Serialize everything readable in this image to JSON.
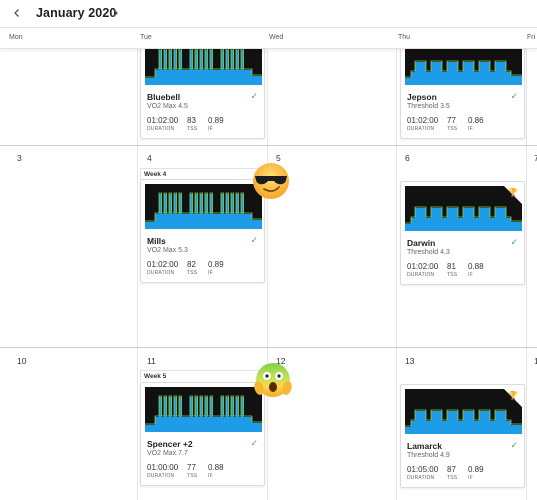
{
  "header": {
    "month": "January 2020",
    "prev_icon": "chevron-left-icon",
    "next_icon": "chevron-right-icon"
  },
  "days": [
    "Mon",
    "Tue",
    "Wed",
    "Thu",
    "Fri"
  ],
  "weeks": [
    {
      "dates": [
        "",
        "",
        "",
        "",
        ""
      ]
    },
    {
      "dates": [
        "3",
        "4",
        "5",
        "6",
        "7"
      ],
      "label": "Week 4"
    },
    {
      "dates": [
        "10",
        "11",
        "12",
        "13",
        "1"
      ],
      "label": "Week 5"
    }
  ],
  "workouts": [
    {
      "name": "Bluebell",
      "subtitle": "VO2 Max 4.5",
      "duration": "01:02:00",
      "tss": "83",
      "if": "0.89",
      "labels": {
        "duration": "DURATION",
        "tss": "TSS",
        "if": "IF"
      },
      "completed": true,
      "chart": "vo2"
    },
    {
      "name": "Jepson",
      "subtitle": "Threshold 3.5",
      "duration": "01:02:00",
      "tss": "77",
      "if": "0.86",
      "labels": {
        "duration": "DURATION",
        "tss": "TSS",
        "if": "IF"
      },
      "completed": true,
      "chart": "threshold"
    },
    {
      "name": "Mills",
      "subtitle": "VO2 Max 5.3",
      "duration": "01:02:00",
      "tss": "82",
      "if": "0.89",
      "labels": {
        "duration": "DURATION",
        "tss": "TSS",
        "if": "IF"
      },
      "completed": true,
      "chart": "vo2"
    },
    {
      "name": "Darwin",
      "subtitle": "Threshold 4.3",
      "duration": "01:02:00",
      "tss": "81",
      "if": "0.88",
      "labels": {
        "duration": "DURATION",
        "tss": "TSS",
        "if": "IF"
      },
      "completed": true,
      "chart": "threshold",
      "achievement": true
    },
    {
      "name": "Spencer +2",
      "subtitle": "VO2 Max 7.7",
      "duration": "01:00:00",
      "tss": "77",
      "if": "0.88",
      "labels": {
        "duration": "DURATION",
        "tss": "TSS",
        "if": "IF"
      },
      "completed": true,
      "chart": "vo2"
    },
    {
      "name": "Lamarck",
      "subtitle": "Threshold 4.9",
      "duration": "01:05:00",
      "tss": "87",
      "if": "0.89",
      "labels": {
        "duration": "DURATION",
        "tss": "TSS",
        "if": "IF"
      },
      "completed": true,
      "chart": "threshold",
      "achievement": true
    }
  ],
  "emojis": [
    "sunglasses-emoji",
    "scared-emoji"
  ],
  "colors": {
    "chart_bg": "#111111",
    "chart_fill": "#1e9ce8",
    "chart_line": "#8bd34b",
    "check": "#3db043",
    "trophy": "#e6b527"
  }
}
